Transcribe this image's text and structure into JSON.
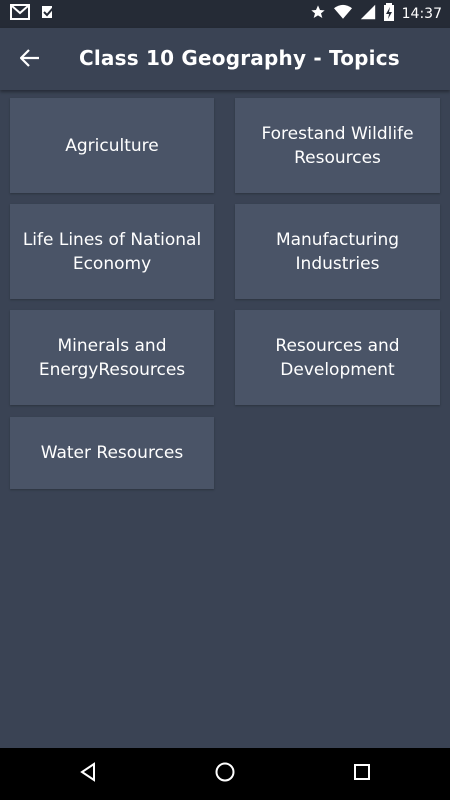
{
  "status_bar": {
    "time": "14:37",
    "icons": [
      "gmail-icon",
      "check-box-icon",
      "star-icon",
      "wifi-icon",
      "signal-icon",
      "battery-charging-icon"
    ]
  },
  "app_bar": {
    "title": "Class 10 Geography - Topics",
    "back_icon": "arrow-back-icon"
  },
  "topics": [
    {
      "label": "Agriculture"
    },
    {
      "label": "Forestand Wildlife Resources"
    },
    {
      "label": "Life Lines of National Economy"
    },
    {
      "label": "Manufacturing Industries"
    },
    {
      "label": "Minerals and EnergyResources"
    },
    {
      "label": "Resources and Development"
    },
    {
      "label": "Water Resources"
    }
  ],
  "nav_bar": {
    "icons": [
      "back-triangle-icon",
      "home-circle-icon",
      "recents-square-icon"
    ]
  },
  "colors": {
    "background": "#3a4354",
    "tile": "#4a5467",
    "status_bar": "#252b36",
    "nav_bar": "#000000",
    "text": "#ffffff"
  }
}
